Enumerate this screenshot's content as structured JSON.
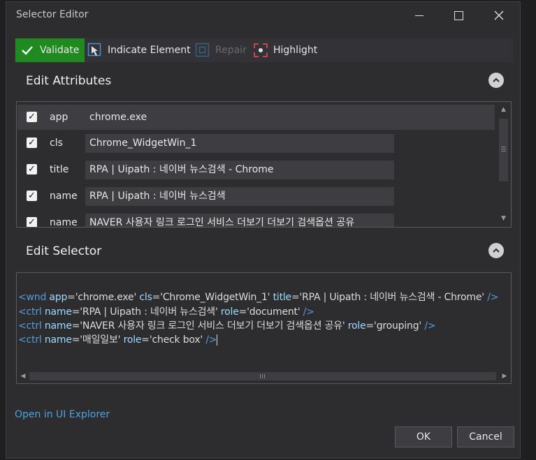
{
  "window": {
    "title": "Selector Editor"
  },
  "toolbar": {
    "validate": "Validate",
    "indicate": "Indicate Element",
    "repair": "Repair",
    "highlight": "Highlight"
  },
  "sections": {
    "attributes_title": "Edit Attributes",
    "selector_title": "Edit Selector"
  },
  "attributes": [
    {
      "checked": true,
      "name": "app",
      "value": "chrome.exe"
    },
    {
      "checked": true,
      "name": "cls",
      "value": "Chrome_WidgetWin_1"
    },
    {
      "checked": true,
      "name": "title",
      "value": "RPA | Uipath : 네이버 뉴스검색 - Chrome"
    },
    {
      "checked": true,
      "name": "name",
      "value": "RPA | Uipath : 네이버 뉴스검색"
    },
    {
      "checked": true,
      "name": "name",
      "value": "NAVER 사용자 링크 로그인 서비스 더보기 더보기 검색옵션 공유"
    }
  ],
  "selector": {
    "line1": {
      "open": "<wnd",
      "a1": "app",
      "v1": "='chrome.exe'",
      "a2": "cls",
      "v2": "='Chrome_WidgetWin_1'",
      "a3": "title",
      "v3": "='RPA | Uipath : 네이버 뉴스검색 - Chrome'",
      "close": "/>"
    },
    "line2": {
      "open": "<ctrl",
      "a1": "name",
      "v1": "='RPA | Uipath : 네이버 뉴스검색'",
      "a2": "role",
      "v2": "='document'",
      "close": "/>"
    },
    "line3": {
      "open": "<ctrl",
      "a1": "name",
      "v1": "='NAVER 사용자 링크 로그인 서비스 더보기 더보기 검색옵션 공유'",
      "a2": "role",
      "v2": "='grouping'",
      "close": "/>"
    },
    "line4": {
      "open": "<ctrl",
      "a1": "name",
      "v1": "='매일일보'",
      "a2": "role",
      "v2": "='check box'",
      "close": "/>"
    }
  },
  "footer": {
    "explorer_link": "Open in UI Explorer",
    "ok": "OK",
    "cancel": "Cancel"
  },
  "colors": {
    "validate_bg": "#1f8a1f",
    "link": "#4aa3df",
    "tag": "#569cd6",
    "attr": "#9cdcfe"
  },
  "icons": {
    "validate": "checkmark-icon",
    "indicate": "cursor-target-icon",
    "repair": "repair-icon",
    "highlight": "highlight-icon",
    "collapse": "chevron-up-icon"
  }
}
